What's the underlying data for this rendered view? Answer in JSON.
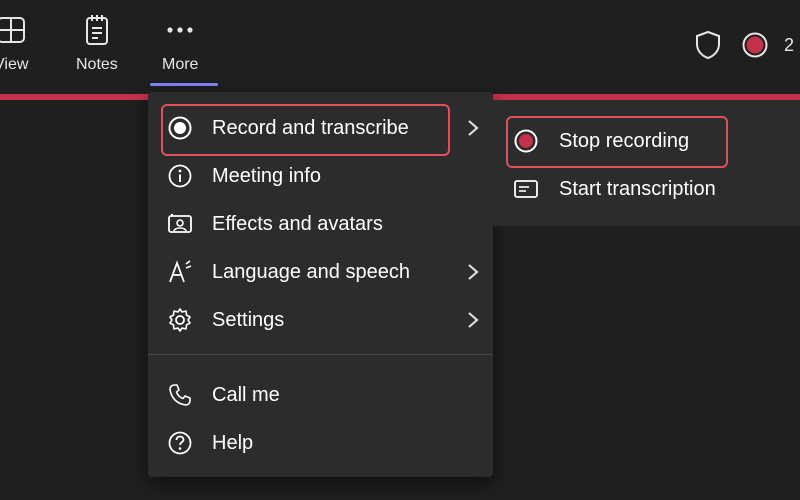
{
  "toolbar": {
    "view_label": "View",
    "notes_label": "Notes",
    "more_label": "More",
    "participant_count": "2"
  },
  "menu": {
    "items": [
      {
        "label": "Record and transcribe",
        "icon": "record-icon",
        "has_submenu": true
      },
      {
        "label": "Meeting info",
        "icon": "info-icon",
        "has_submenu": false
      },
      {
        "label": "Effects and avatars",
        "icon": "effects-icon",
        "has_submenu": false
      },
      {
        "label": "Language and speech",
        "icon": "language-icon",
        "has_submenu": true
      },
      {
        "label": "Settings",
        "icon": "gear-icon",
        "has_submenu": true
      },
      {
        "label": "Call me",
        "icon": "phone-icon",
        "has_submenu": false
      },
      {
        "label": "Help",
        "icon": "help-icon",
        "has_submenu": false
      }
    ]
  },
  "submenu": {
    "items": [
      {
        "label": "Stop recording",
        "icon": "recording-dot-icon"
      },
      {
        "label": "Start transcription",
        "icon": "transcript-icon"
      }
    ]
  },
  "colors": {
    "background": "#1f1f1f",
    "menu_bg": "#2d2c2c",
    "recording_red": "#c4314b",
    "highlight_red": "#e0505c",
    "accent": "#7f85f5"
  }
}
